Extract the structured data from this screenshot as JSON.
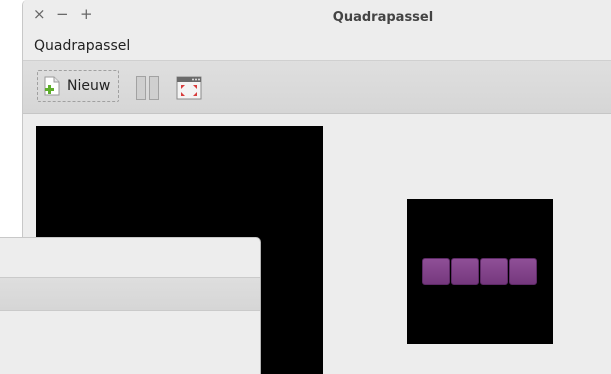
{
  "window": {
    "title": "Quadrapassel",
    "controls": {
      "close": "×",
      "minimize": "−",
      "maximize": "+"
    }
  },
  "menubar": {
    "app_menu": "Quadrapassel"
  },
  "toolbar": {
    "new_label": "Nieuw"
  },
  "game": {
    "next_piece": {
      "shape": "I",
      "color": "#8a4a93",
      "blocks": 4
    }
  },
  "dialog": {}
}
